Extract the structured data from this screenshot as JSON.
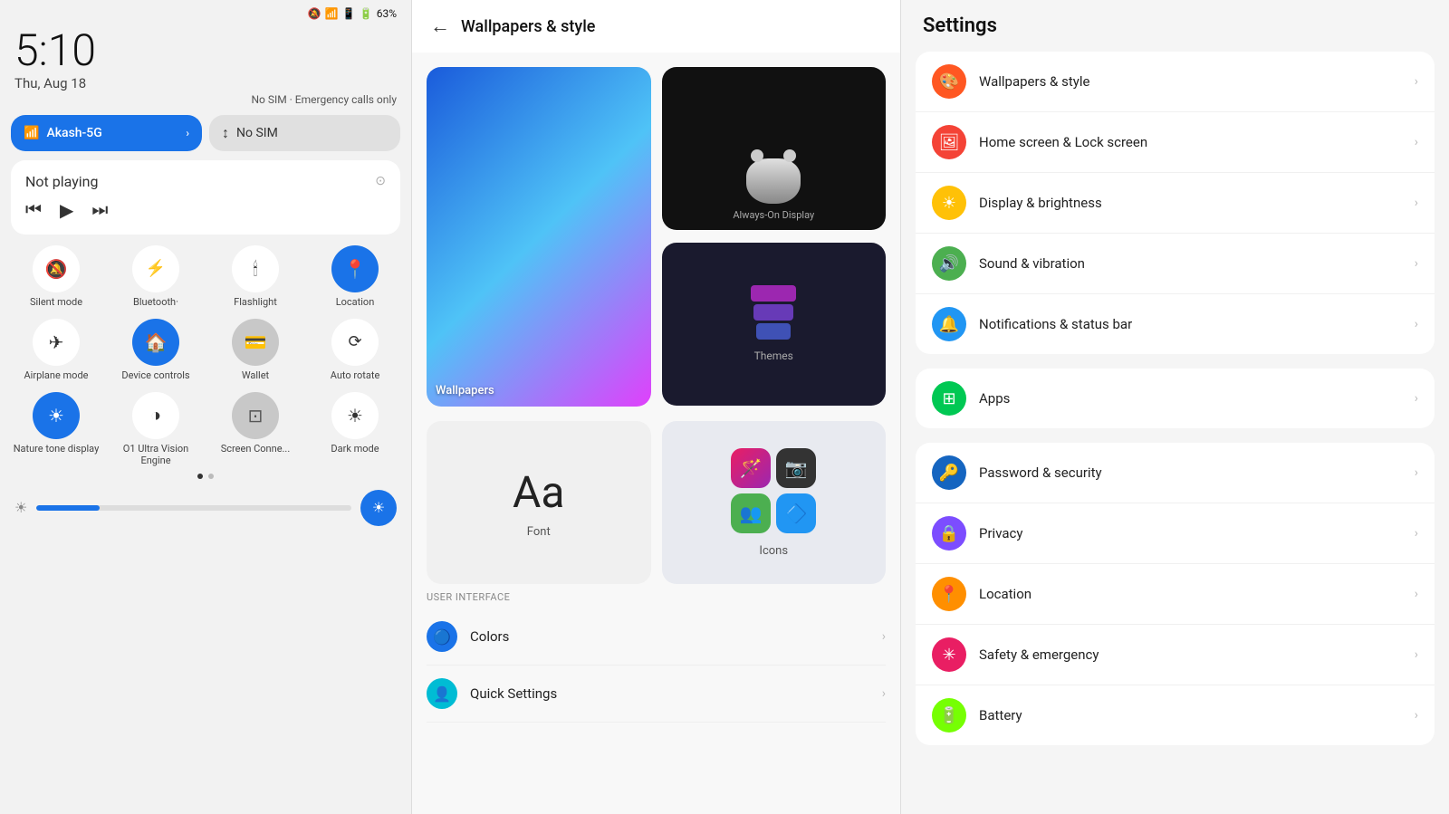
{
  "panel1": {
    "status": {
      "time": "5:10",
      "date": "Thu, Aug 18",
      "battery": "63%",
      "sim_info": "No SIM · Emergency calls only"
    },
    "wifi": {
      "label": "Akash-5G",
      "arrow": "›"
    },
    "sim": {
      "label": "No SIM"
    },
    "media": {
      "title": "Not playing"
    },
    "tiles": [
      {
        "id": "silent",
        "label": "Silent mode",
        "icon": "🔕",
        "active": false
      },
      {
        "id": "bluetooth",
        "label": "Bluetooth·",
        "icon": "⚡",
        "active": false
      },
      {
        "id": "flashlight",
        "label": "Flashlight",
        "icon": "🕯",
        "active": false
      },
      {
        "id": "location",
        "label": "Location",
        "icon": "📍",
        "active": true
      },
      {
        "id": "airplane",
        "label": "Airplane mode",
        "icon": "✈",
        "active": false
      },
      {
        "id": "device",
        "label": "Device controls",
        "icon": "🏠",
        "active": true
      },
      {
        "id": "wallet",
        "label": "Wallet",
        "icon": "💳",
        "active": false
      },
      {
        "id": "autorotate",
        "label": "Auto rotate",
        "icon": "⟳",
        "active": false
      },
      {
        "id": "nature",
        "label": "Nature tone display",
        "icon": "☀",
        "active": true
      },
      {
        "id": "o1ultra",
        "label": "O1 Ultra Vision Engine",
        "icon": "◑",
        "active": false
      },
      {
        "id": "screenconn",
        "label": "Screen Connect",
        "icon": "⊡",
        "active": false
      },
      {
        "id": "darkmode",
        "label": "Dark mode",
        "icon": "☀",
        "active": false
      }
    ]
  },
  "panel2": {
    "header": {
      "back": "←",
      "title": "Wallpapers & style"
    },
    "wallpapers": [
      {
        "id": "wallpapers",
        "label": "Wallpapers"
      },
      {
        "id": "aod",
        "label": "Always-On Display"
      },
      {
        "id": "themes",
        "label": "Themes"
      }
    ],
    "font": {
      "label": "Font",
      "sample": "Aa"
    },
    "icons_label": "Icons",
    "section": "USER INTERFACE",
    "items": [
      {
        "id": "colors",
        "label": "Colors",
        "icon": "🔵"
      },
      {
        "id": "quick-settings",
        "label": "Quick Settings",
        "icon": "👤"
      }
    ]
  },
  "panel3": {
    "title": "Settings",
    "group1": [
      {
        "id": "wallpapers-style",
        "label": "Wallpapers & style",
        "color": "s-orange"
      },
      {
        "id": "home-lock",
        "label": "Home screen & Lock screen",
        "color": "s-red"
      },
      {
        "id": "display-brightness",
        "label": "Display & brightness",
        "color": "s-yellow"
      },
      {
        "id": "sound-vibration",
        "label": "Sound & vibration",
        "color": "s-green"
      },
      {
        "id": "notifications-status",
        "label": "Notifications & status bar",
        "color": "s-blue"
      }
    ],
    "group2": [
      {
        "id": "apps",
        "label": "Apps",
        "color": "s-green2"
      }
    ],
    "group3": [
      {
        "id": "password-security",
        "label": "Password & security",
        "color": "s-blue2"
      },
      {
        "id": "privacy",
        "label": "Privacy",
        "color": "s-purple"
      },
      {
        "id": "location",
        "label": "Location",
        "color": "s-gold"
      },
      {
        "id": "safety-emergency",
        "label": "Safety & emergency",
        "color": "s-pink"
      },
      {
        "id": "battery",
        "label": "Battery",
        "color": "s-lime"
      }
    ]
  }
}
